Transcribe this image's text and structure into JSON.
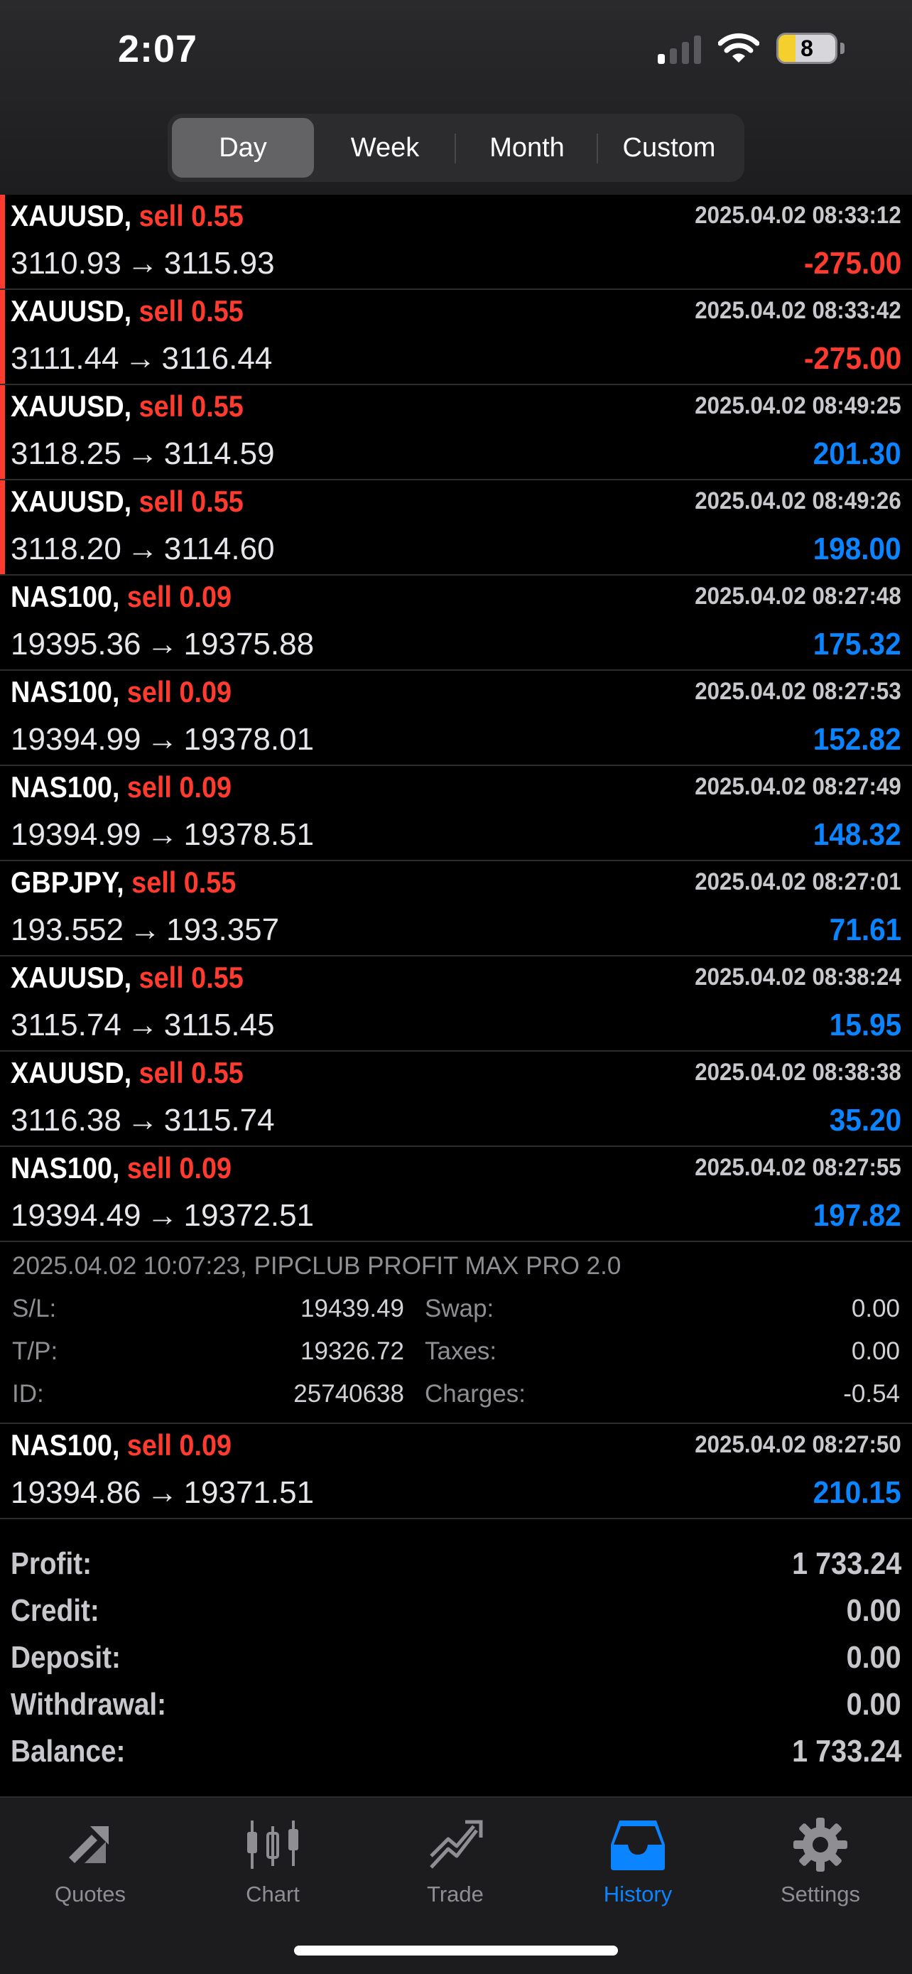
{
  "status_bar": {
    "time": "2:07",
    "battery_level": "8",
    "battery_fraction": 0.08,
    "signal_bars_active": 1
  },
  "period_tabs": [
    {
      "label": "Day",
      "active": true
    },
    {
      "label": "Week",
      "active": false
    },
    {
      "label": "Month",
      "active": false
    },
    {
      "label": "Custom",
      "active": false
    }
  ],
  "arrow": "→",
  "deals_top": [
    {
      "symbol": "XAUUSD,",
      "side": "sell 0.55",
      "time": "2025.04.02 08:33:12",
      "open": "3110.93",
      "close": "3115.93",
      "profit": "-275.00",
      "negative": true,
      "marked": true
    },
    {
      "symbol": "XAUUSD,",
      "side": "sell 0.55",
      "time": "2025.04.02 08:33:42",
      "open": "3111.44",
      "close": "3116.44",
      "profit": "-275.00",
      "negative": true,
      "marked": true
    },
    {
      "symbol": "XAUUSD,",
      "side": "sell 0.55",
      "time": "2025.04.02 08:49:25",
      "open": "3118.25",
      "close": "3114.59",
      "profit": "201.30",
      "negative": false,
      "marked": true
    },
    {
      "symbol": "XAUUSD,",
      "side": "sell 0.55",
      "time": "2025.04.02 08:49:26",
      "open": "3118.20",
      "close": "3114.60",
      "profit": "198.00",
      "negative": false,
      "marked": true
    },
    {
      "symbol": "NAS100,",
      "side": "sell 0.09",
      "time": "2025.04.02 08:27:48",
      "open": "19395.36",
      "close": "19375.88",
      "profit": "175.32",
      "negative": false,
      "marked": false
    },
    {
      "symbol": "NAS100,",
      "side": "sell 0.09",
      "time": "2025.04.02 08:27:53",
      "open": "19394.99",
      "close": "19378.01",
      "profit": "152.82",
      "negative": false,
      "marked": false
    },
    {
      "symbol": "NAS100,",
      "side": "sell 0.09",
      "time": "2025.04.02 08:27:49",
      "open": "19394.99",
      "close": "19378.51",
      "profit": "148.32",
      "negative": false,
      "marked": false
    },
    {
      "symbol": "GBPJPY,",
      "side": "sell 0.55",
      "time": "2025.04.02 08:27:01",
      "open": "193.552",
      "close": "193.357",
      "profit": "71.61",
      "negative": false,
      "marked": false
    },
    {
      "symbol": "XAUUSD,",
      "side": "sell 0.55",
      "time": "2025.04.02 08:38:24",
      "open": "3115.74",
      "close": "3115.45",
      "profit": "15.95",
      "negative": false,
      "marked": false
    },
    {
      "symbol": "XAUUSD,",
      "side": "sell 0.55",
      "time": "2025.04.02 08:38:38",
      "open": "3116.38",
      "close": "3115.74",
      "profit": "35.20",
      "negative": false,
      "marked": false
    },
    {
      "symbol": "NAS100,",
      "side": "sell 0.09",
      "time": "2025.04.02 08:27:55",
      "open": "19394.49",
      "close": "19372.51",
      "profit": "197.82",
      "negative": false,
      "marked": false
    }
  ],
  "details": {
    "comment": "2025.04.02 10:07:23, PIPCLUB PROFIT MAX PRO 2.0",
    "sl_label": "S/L:",
    "sl_value": "19439.49",
    "tp_label": "T/P:",
    "tp_value": "19326.72",
    "id_label": "ID:",
    "id_value": "25740638",
    "swap_label": "Swap:",
    "swap_value": "0.00",
    "taxes_label": "Taxes:",
    "taxes_value": "0.00",
    "charges_label": "Charges:",
    "charges_value": "-0.54"
  },
  "deals_bottom": [
    {
      "symbol": "NAS100,",
      "side": "sell 0.09",
      "time": "2025.04.02 08:27:50",
      "open": "19394.86",
      "close": "19371.51",
      "profit": "210.15",
      "negative": false,
      "marked": false
    }
  ],
  "summary": [
    {
      "label": "Profit:",
      "value": "1 733.24"
    },
    {
      "label": "Credit:",
      "value": "0.00"
    },
    {
      "label": "Deposit:",
      "value": "0.00"
    },
    {
      "label": "Withdrawal:",
      "value": "0.00"
    },
    {
      "label": "Balance:",
      "value": "1 733.24"
    }
  ],
  "tab_bar": [
    {
      "label": "Quotes",
      "icon": "quotes-icon",
      "active": false
    },
    {
      "label": "Chart",
      "icon": "chart-icon",
      "active": false
    },
    {
      "label": "Trade",
      "icon": "trade-icon",
      "active": false
    },
    {
      "label": "History",
      "icon": "history-icon",
      "active": true
    },
    {
      "label": "Settings",
      "icon": "settings-icon",
      "active": false
    }
  ],
  "colors": {
    "loss": "#ff3b30",
    "profit": "#0a84ff",
    "accent": "#0a84ff",
    "inactive": "#8e8e93"
  }
}
